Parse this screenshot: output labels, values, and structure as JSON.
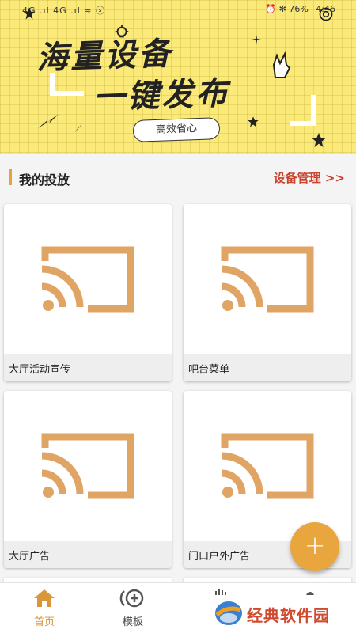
{
  "statusbar": {
    "left_text": "4G .ıl 4G .ıl ≈ ⓢ",
    "battery": "✻ 76%",
    "time": "4:46"
  },
  "banner": {
    "headline_line1": "海量设备",
    "headline_line2": "一键发布",
    "slogan": "高效省心"
  },
  "section": {
    "title": "我的投放",
    "manage_link": "设备管理 >>"
  },
  "cards": [
    {
      "label": "大厅活动宣传",
      "icon": "cast-icon"
    },
    {
      "label": "吧台菜单",
      "icon": "cast-icon"
    },
    {
      "label": "大厅广告",
      "icon": "cast-icon"
    },
    {
      "label": "门口户外广告",
      "icon": "cast-icon"
    }
  ],
  "fab": {
    "label": "+"
  },
  "nav": {
    "home": "首页",
    "template": "模板"
  },
  "watermark": {
    "text": "经典软件园"
  },
  "colors": {
    "accent": "#e9a63f",
    "banner_bg": "#fbe97a",
    "link": "#c9442f",
    "cast_icon": "#e0a464"
  }
}
